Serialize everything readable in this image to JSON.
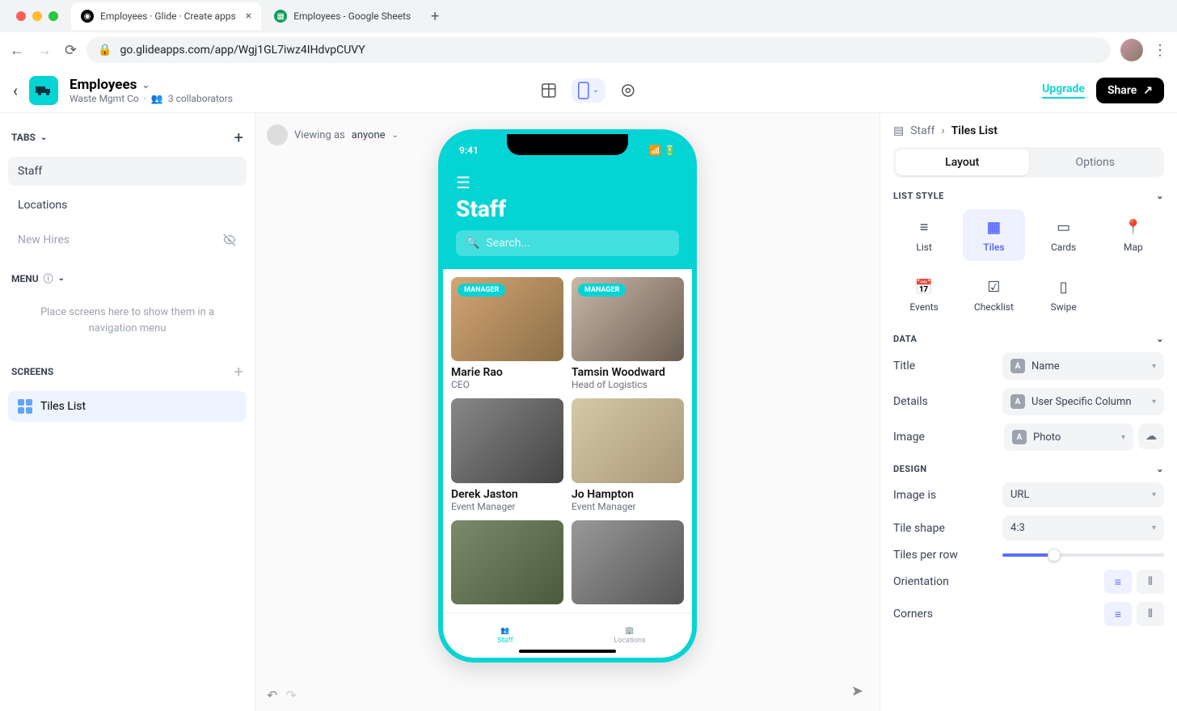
{
  "browser": {
    "tabs": [
      {
        "title": "Employees · Glide · Create apps",
        "active": true
      },
      {
        "title": "Employees - Google Sheets",
        "active": false
      }
    ],
    "url": "go.glideapps.com/app/Wgj1GL7iwz4IHdvpCUVY"
  },
  "app": {
    "name": "Employees",
    "org": "Waste Mgmt Co",
    "collaborators": "3 collaborators",
    "upgrade_label": "Upgrade",
    "share_label": "Share"
  },
  "left": {
    "tabs_label": "TABS",
    "tabs": [
      {
        "label": "Staff",
        "active": true,
        "hidden": false
      },
      {
        "label": "Locations",
        "active": false,
        "hidden": false
      },
      {
        "label": "New Hires",
        "active": false,
        "hidden": true
      }
    ],
    "menu_label": "MENU",
    "menu_hint": "Place screens here to show them in a navigation menu",
    "screens_label": "SCREENS",
    "screens": [
      {
        "label": "Tiles List",
        "active": true
      }
    ]
  },
  "viewing": {
    "prefix": "Viewing as",
    "who": "anyone"
  },
  "phone": {
    "time": "9:41",
    "screen_title": "Staff",
    "search_placeholder": "Search...",
    "tiles": [
      {
        "name": "Marie Rao",
        "role": "CEO",
        "badge": "MANAGER",
        "img": "p1"
      },
      {
        "name": "Tamsin Woodward",
        "role": "Head of Logistics",
        "badge": "MANAGER",
        "img": "p2"
      },
      {
        "name": "Derek Jaston",
        "role": "Event Manager",
        "badge": null,
        "img": "p3"
      },
      {
        "name": "Jo Hampton",
        "role": "Event Manager",
        "badge": null,
        "img": "p4"
      },
      {
        "name": "",
        "role": "",
        "badge": null,
        "img": "p5"
      },
      {
        "name": "",
        "role": "",
        "badge": null,
        "img": "p6"
      }
    ],
    "tabbar": [
      {
        "label": "Staff",
        "active": true
      },
      {
        "label": "Locations",
        "active": false
      }
    ]
  },
  "right": {
    "crumb_parent": "Staff",
    "crumb_current": "Tiles List",
    "seg": [
      {
        "label": "Layout",
        "active": true
      },
      {
        "label": "Options",
        "active": false
      }
    ],
    "list_style_label": "LIST STYLE",
    "styles": [
      {
        "label": "List"
      },
      {
        "label": "Tiles"
      },
      {
        "label": "Cards"
      },
      {
        "label": "Map"
      },
      {
        "label": "Events"
      },
      {
        "label": "Checklist"
      },
      {
        "label": "Swipe"
      }
    ],
    "styles_active": "Tiles",
    "data_label": "DATA",
    "data_rows": {
      "title": {
        "label": "Title",
        "value": "Name"
      },
      "details": {
        "label": "Details",
        "value": "User Specific Column"
      },
      "image": {
        "label": "Image",
        "value": "Photo"
      }
    },
    "design_label": "DESIGN",
    "design": {
      "image_is": {
        "label": "Image is",
        "value": "URL"
      },
      "tile_shape": {
        "label": "Tile shape",
        "value": "4:3"
      },
      "tiles_per_row": {
        "label": "Tiles per row"
      },
      "orientation": {
        "label": "Orientation"
      },
      "corners": {
        "label": "Corners"
      }
    }
  }
}
